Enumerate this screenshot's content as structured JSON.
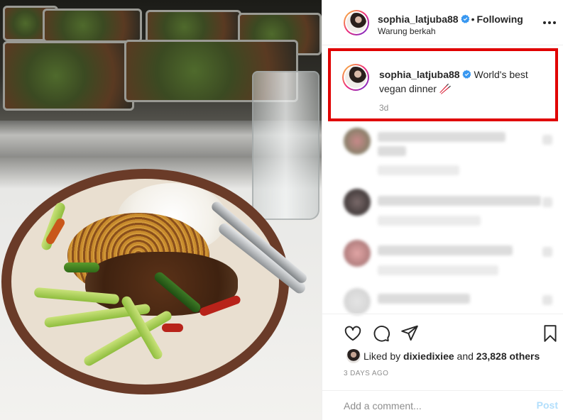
{
  "post": {
    "photo_alt": "Plate of rice, noodles and vegetables"
  },
  "header": {
    "username": "sophia_latjuba88",
    "verified": true,
    "separator": "•",
    "follow_label": "Following",
    "location": "Warung berkah",
    "more_icon": "more-horizontal-icon"
  },
  "caption": {
    "username": "sophia_latjuba88",
    "text": "World's best vegan dinner 🥢",
    "time": "3d",
    "highlight_color": "#e00000"
  },
  "actions": {
    "like_icon": "heart-icon",
    "comment_icon": "comment-icon",
    "share_icon": "paper-plane-icon",
    "save_icon": "bookmark-icon"
  },
  "likes": {
    "prefix": "Liked by",
    "user": "dixiedixiee",
    "conj": "and",
    "count": "23,828 others"
  },
  "timestamp": "3 DAYS AGO",
  "comment": {
    "placeholder": "Add a comment...",
    "post_label": "Post"
  },
  "colors": {
    "verified_blue": "#3897f0",
    "post_disabled": "#b2dffc",
    "muted_text": "#8e8e8e"
  }
}
